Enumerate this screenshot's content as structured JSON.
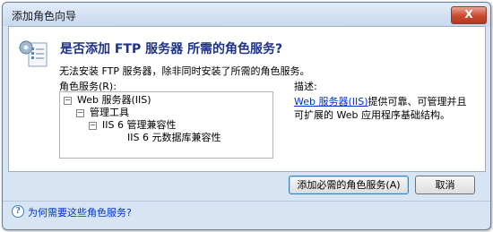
{
  "window": {
    "title": "添加角色向导",
    "close_label": "X"
  },
  "heading": "是否添加 FTP 服务器 所需的角色服务?",
  "warning": "无法安装 FTP 服务器，除非同时安装了所需的角色服务。",
  "role_services_label": "角色服务(R):",
  "tree": [
    {
      "label": "Web 服务器(IIS)",
      "expander": "⊟"
    },
    {
      "label": "管理工具",
      "expander": "⊟"
    },
    {
      "label": "IIS 6 管理兼容性",
      "expander": "⊟"
    },
    {
      "label": "IIS 6 元数据库兼容性",
      "expander": ""
    }
  ],
  "description": {
    "label": "描述:",
    "link": "Web 服务器(IIS)",
    "text": "提供可靠、可管理并且可扩展的 Web 应用程序基础结构。"
  },
  "buttons": {
    "add": "添加必需的角色服务(A)",
    "cancel": "取消"
  },
  "help": {
    "icon": "?",
    "link": "为何需要这些角色服务?"
  }
}
